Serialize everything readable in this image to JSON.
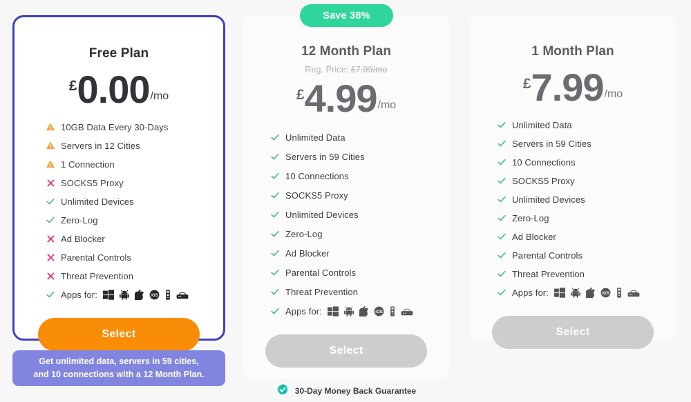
{
  "badge": {
    "save_label": "Save 38%"
  },
  "plans": [
    {
      "id": "free",
      "title": "Free Plan",
      "currency": "£",
      "amount": "0.00",
      "per": "/mo",
      "reg_price_prefix": "",
      "reg_price_value": "",
      "features": [
        {
          "icon": "warning-icon",
          "label": "10GB Data Every 30-Days"
        },
        {
          "icon": "warning-icon",
          "label": "Servers in 12 Cities"
        },
        {
          "icon": "warning-icon",
          "label": "1 Connection"
        },
        {
          "icon": "cross-icon",
          "label": "SOCKS5 Proxy"
        },
        {
          "icon": "check-icon",
          "label": "Unlimited Devices"
        },
        {
          "icon": "check-icon",
          "label": "Zero-Log"
        },
        {
          "icon": "cross-icon",
          "label": "Ad Blocker"
        },
        {
          "icon": "cross-icon",
          "label": "Parental Controls"
        },
        {
          "icon": "cross-icon",
          "label": "Threat Prevention"
        }
      ],
      "apps_label": "Apps for:",
      "apps_icon": "check-icon",
      "platforms": [
        "windows-icon",
        "android-icon",
        "apple-icon",
        "ios-icon",
        "firestick-icon",
        "router-icon"
      ],
      "button_label": "Select",
      "button_style": "orange"
    },
    {
      "id": "12-month",
      "title": "12 Month Plan",
      "currency": "£",
      "amount": "4.99",
      "per": "/mo",
      "reg_price_prefix": "Reg. Price: ",
      "reg_price_value": "£7.99/mo",
      "features": [
        {
          "icon": "check-icon",
          "label": "Unlimited Data"
        },
        {
          "icon": "check-icon",
          "label": "Servers in 59 Cities"
        },
        {
          "icon": "check-icon",
          "label": "10 Connections"
        },
        {
          "icon": "check-icon",
          "label": "SOCKS5 Proxy"
        },
        {
          "icon": "check-icon",
          "label": "Unlimited Devices"
        },
        {
          "icon": "check-icon",
          "label": "Zero-Log"
        },
        {
          "icon": "check-icon",
          "label": "Ad Blocker"
        },
        {
          "icon": "check-icon",
          "label": "Parental Controls"
        },
        {
          "icon": "check-icon",
          "label": "Threat Prevention"
        }
      ],
      "apps_label": "Apps for:",
      "apps_icon": "check-icon",
      "platforms": [
        "windows-icon",
        "android-icon",
        "apple-icon",
        "ios-icon",
        "firestick-icon",
        "router-icon"
      ],
      "button_label": "Select",
      "button_style": "grey",
      "guarantee_label": "30-Day Money Back Guarantee",
      "guarantee_icon": "verified-badge-icon"
    },
    {
      "id": "1-month",
      "title": "1 Month Plan",
      "currency": "£",
      "amount": "7.99",
      "per": "/mo",
      "reg_price_prefix": "",
      "reg_price_value": "",
      "features": [
        {
          "icon": "check-icon",
          "label": "Unlimited Data"
        },
        {
          "icon": "check-icon",
          "label": "Servers in 59 Cities"
        },
        {
          "icon": "check-icon",
          "label": "10 Connections"
        },
        {
          "icon": "check-icon",
          "label": "SOCKS5 Proxy"
        },
        {
          "icon": "check-icon",
          "label": "Unlimited Devices"
        },
        {
          "icon": "check-icon",
          "label": "Zero-Log"
        },
        {
          "icon": "check-icon",
          "label": "Ad Blocker"
        },
        {
          "icon": "check-icon",
          "label": "Parental Controls"
        },
        {
          "icon": "check-icon",
          "label": "Threat Prevention"
        }
      ],
      "apps_label": "Apps for:",
      "apps_icon": "check-icon",
      "platforms": [
        "windows-icon",
        "android-icon",
        "apple-icon",
        "ios-icon",
        "firestick-icon",
        "router-icon"
      ],
      "button_label": "Select",
      "button_style": "grey"
    }
  ],
  "callout": {
    "line1": "Get unlimited data, servers in 59 cities,",
    "line2": "and 10 connections with a 12 Month Plan."
  },
  "colors": {
    "highlight_border": "#3f3fc4",
    "badge_green": "#2fd69b",
    "cta_orange": "#f98d08",
    "cta_disabled": "#cdcdcd",
    "check_green": "#4cb98a",
    "warning_orange": "#f2a33c",
    "cross_pink": "#e43a7f",
    "callout_purple": "#8285e0",
    "page_background": "#f7f7f7"
  }
}
